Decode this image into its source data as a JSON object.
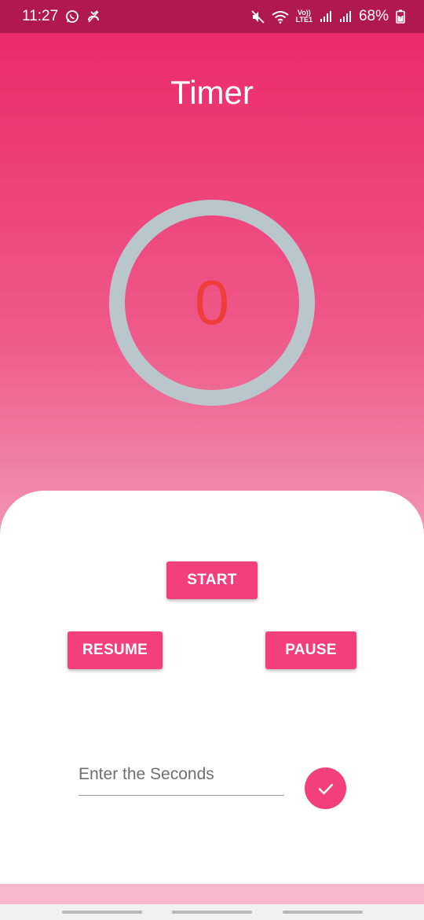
{
  "status_bar": {
    "time": "11:27",
    "battery": "68%",
    "lte_top": "Vo))",
    "lte_bottom": "LTE1",
    "left_icons": [
      "whatsapp-icon",
      "missed-call-icon"
    ],
    "right_icons": [
      "mute-icon",
      "wifi-icon",
      "signal-icon",
      "signal-icon",
      "battery-charging-icon"
    ]
  },
  "app": {
    "title": "Timer",
    "timer_value": "0"
  },
  "controls": {
    "start_label": "START",
    "resume_label": "RESUME",
    "pause_label": "PAUSE"
  },
  "input": {
    "placeholder": "Enter the Seconds",
    "value": ""
  },
  "submit": {
    "icon": "check-icon"
  },
  "colors": {
    "status_bar": "#b0194d",
    "gradient_top": "#ec2a6b",
    "gradient_bottom": "#f6b6cc",
    "accent": "#f33f7c",
    "ring": "#b9c6cc",
    "timer_text": "#ef3d3a"
  }
}
